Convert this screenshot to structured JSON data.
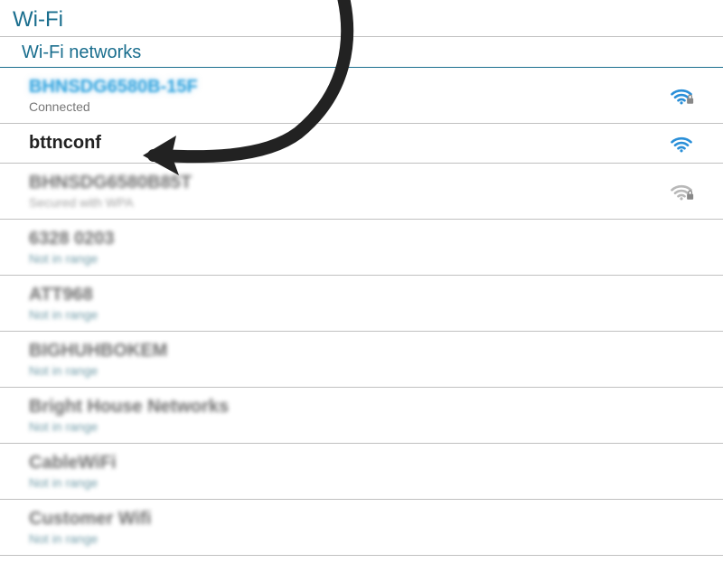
{
  "title": "Wi-Fi",
  "section": "Wi-Fi networks",
  "networks": [
    {
      "name": "BHNSDG6580B-15F",
      "status": "Connected",
      "signal": "strong",
      "secured": true,
      "highlighted": true
    },
    {
      "name": "bttnconf",
      "status": "",
      "signal": "strong",
      "secured": false,
      "focus": true
    },
    {
      "name": "BHNSDG6580B85T",
      "status": "Secured with WPA",
      "signal": "weak",
      "secured": true,
      "blurred": true
    },
    {
      "name": "6328 0203",
      "status": "Not in range",
      "signal": "none",
      "secured": false,
      "blurred": true
    },
    {
      "name": "ATT968",
      "status": "Not in range",
      "signal": "none",
      "secured": false,
      "blurred": true
    },
    {
      "name": "BIGHUHBOKEM",
      "status": "Not in range",
      "signal": "none",
      "secured": false,
      "blurred": true
    },
    {
      "name": "Bright House Networks",
      "status": "Not in range",
      "signal": "none",
      "secured": false,
      "blurred": true
    },
    {
      "name": "CableWiFi",
      "status": "Not in range",
      "signal": "none",
      "secured": false,
      "blurred": true
    },
    {
      "name": "Customer Wifi",
      "status": "Not in range",
      "signal": "none",
      "secured": false,
      "blurred": true
    }
  ]
}
